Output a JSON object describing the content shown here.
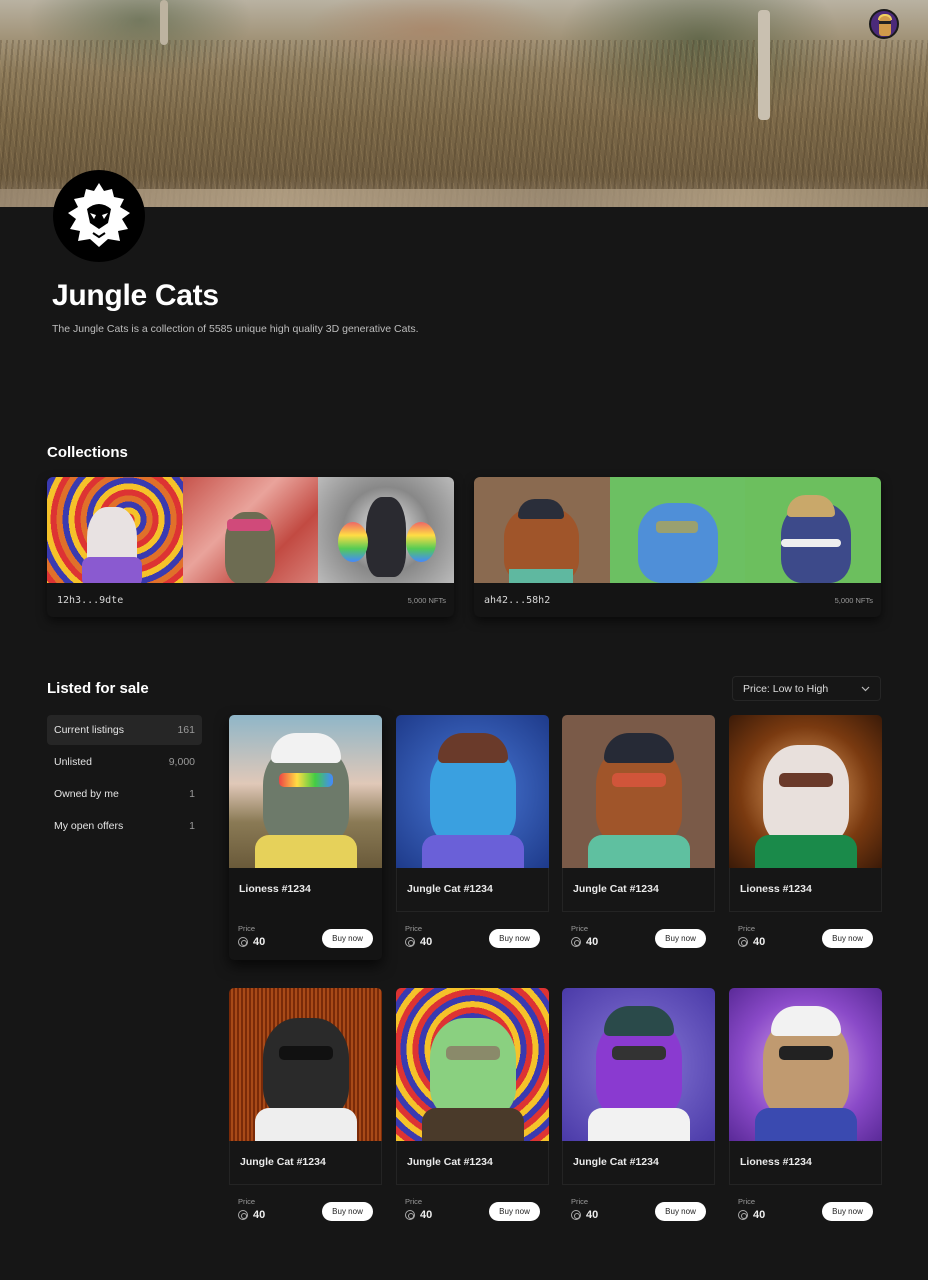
{
  "header": {
    "user_avatar": "user-avatar",
    "collection_title": "Jungle Cats",
    "collection_description": "The Jungle Cats is a collection of 5585 unique high quality 3D generative Cats."
  },
  "collections": {
    "heading": "Collections",
    "items": [
      {
        "address": "12h3...9dte",
        "count": "5,000 NFTs",
        "thumbs": [
          "psychedelic-swirl",
          "red-fur",
          "grey-fur"
        ]
      },
      {
        "address": "ah42...58h2",
        "count": "5,000 NFTs",
        "thumbs": [
          "brown",
          "green",
          "green"
        ]
      }
    ]
  },
  "listed": {
    "heading": "Listed for sale",
    "sort": {
      "selected": "Price: Low to High"
    },
    "filters": [
      {
        "label": "Current listings",
        "count": "161",
        "active": true
      },
      {
        "label": "Unlisted",
        "count": "9,000"
      },
      {
        "label": "Owned by me",
        "count": "1"
      },
      {
        "label": "My open offers",
        "count": "1"
      }
    ],
    "price_label": "Price",
    "buy_label": "Buy now",
    "cards": [
      {
        "name": "Lioness #1234",
        "price": "40"
      },
      {
        "name": "Jungle Cat #1234",
        "price": "40"
      },
      {
        "name": "Jungle Cat #1234",
        "price": "40"
      },
      {
        "name": "Lioness #1234",
        "price": "40"
      },
      {
        "name": "Jungle Cat #1234",
        "price": "40"
      },
      {
        "name": "Jungle Cat #1234",
        "price": "40"
      },
      {
        "name": "Jungle Cat #1234",
        "price": "40"
      },
      {
        "name": "Lioness #1234",
        "price": "40"
      }
    ]
  },
  "colors": {
    "background": "#161616",
    "button": "#ffffff",
    "active_filter": "#262626"
  }
}
